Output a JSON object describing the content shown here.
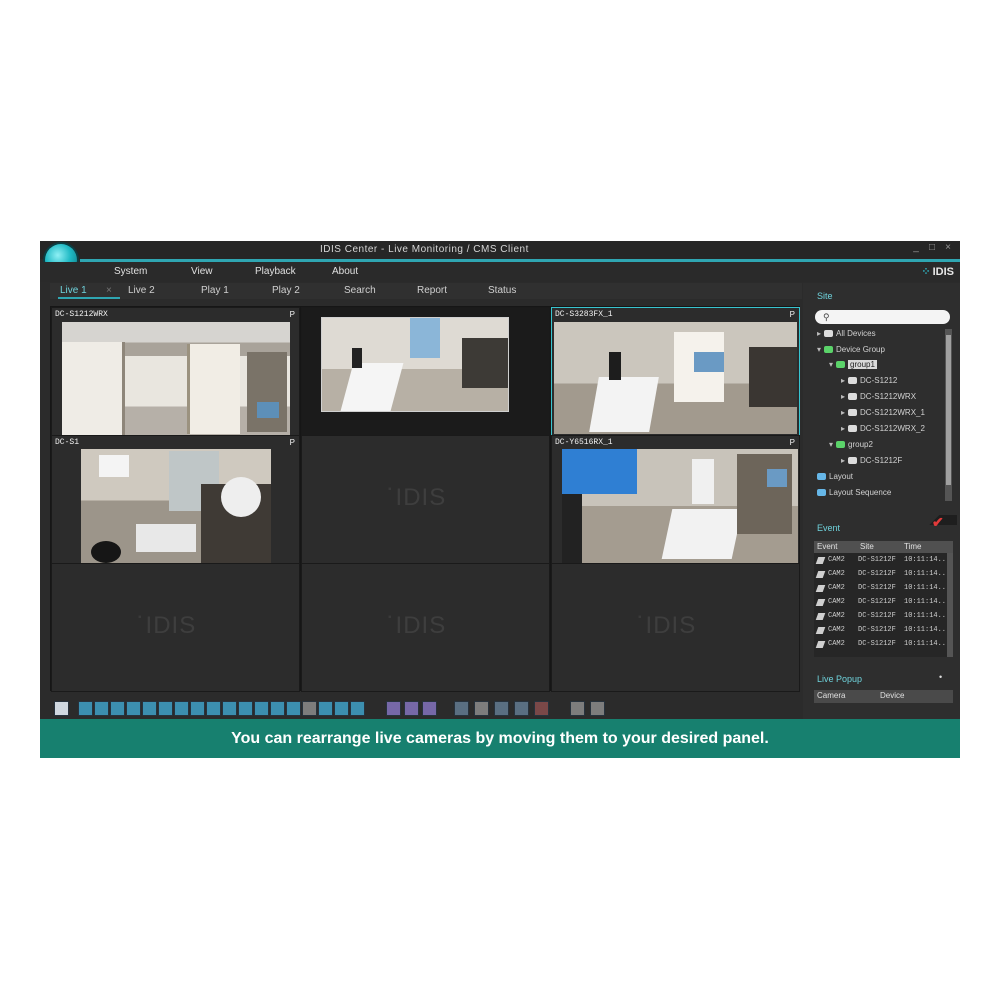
{
  "window": {
    "title": "IDIS Center - Live Monitoring / CMS Client",
    "controls": [
      "_",
      "□",
      "×"
    ]
  },
  "brand": {
    "name": "IDIS"
  },
  "menu": [
    "System",
    "View",
    "Playback",
    "About"
  ],
  "tabs": [
    {
      "label": "Live 1",
      "active": true
    },
    {
      "label": "Live 2"
    },
    {
      "label": "Play 1"
    },
    {
      "label": "Play 2"
    },
    {
      "label": "Search"
    },
    {
      "label": "Report"
    },
    {
      "label": "Status"
    }
  ],
  "cameras": [
    {
      "label": "DC-S1212WRX",
      "badge": "P"
    },
    {
      "label": "",
      "badge": ""
    },
    {
      "label": "DC-S3283FX_1",
      "badge": "P"
    },
    {
      "label": "DC-S1",
      "badge": "P"
    },
    {
      "label": "",
      "badge": ""
    },
    {
      "label": "DC-Y6516RX_1",
      "badge": "P"
    },
    {
      "label": "",
      "badge": ""
    },
    {
      "label": "",
      "badge": ""
    },
    {
      "label": "",
      "badge": ""
    }
  ],
  "watermark": "IDIS",
  "sidebar": {
    "site_title": "Site",
    "search_placeholder": "",
    "tree": [
      {
        "label": "All Devices",
        "level": 0,
        "icon": "white"
      },
      {
        "label": "Device Group",
        "level": 0,
        "icon": "green"
      },
      {
        "label": "group1",
        "level": 1,
        "icon": "green",
        "selected": true
      },
      {
        "label": "DC-S1212",
        "level": 2,
        "icon": "white"
      },
      {
        "label": "DC-S1212WRX",
        "level": 2,
        "icon": "white"
      },
      {
        "label": "DC-S1212WRX_1",
        "level": 2,
        "icon": "white"
      },
      {
        "label": "DC-S1212WRX_2",
        "level": 2,
        "icon": "white"
      },
      {
        "label": "group2",
        "level": 1,
        "icon": "green"
      },
      {
        "label": "DC-S1212F",
        "level": 2,
        "icon": "white"
      },
      {
        "label": "Layout",
        "level": 0,
        "icon": "blue"
      },
      {
        "label": "Layout Sequence",
        "level": 0,
        "icon": "blue"
      }
    ],
    "event_title": "Event",
    "event_columns": [
      "Event",
      "Site",
      "Time"
    ],
    "events": [
      {
        "event": "CAM2",
        "site": "DC-S1212F",
        "time": "10:11:14..."
      },
      {
        "event": "CAM2",
        "site": "DC-S1212F",
        "time": "10:11:14..."
      },
      {
        "event": "CAM2",
        "site": "DC-S1212F",
        "time": "10:11:14..."
      },
      {
        "event": "CAM2",
        "site": "DC-S1212F",
        "time": "10:11:14..."
      },
      {
        "event": "CAM2",
        "site": "DC-S1212F",
        "time": "10:11:14..."
      },
      {
        "event": "CAM2",
        "site": "DC-S1212F",
        "time": "10:11:14..."
      },
      {
        "event": "CAM2",
        "site": "DC-S1212F",
        "time": "10:11:14..."
      }
    ],
    "live_popup_title": "Live Popup",
    "live_popup_columns": [
      "Camera",
      "Device"
    ]
  },
  "caption": "You can rearrange live cameras by moving them to your desired panel.",
  "colors": {
    "accent": "#2fa6b2",
    "caption_bg": "#17806f",
    "app_bg": "#2b2b2b",
    "selected_border": "#38c4cf",
    "check_red": "#e13a3a"
  }
}
